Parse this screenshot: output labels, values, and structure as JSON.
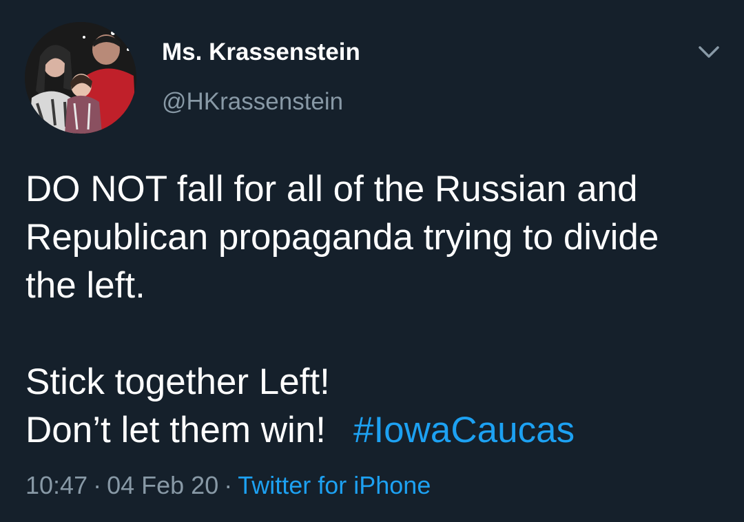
{
  "author": {
    "display_name": "Ms. Krassenstein",
    "handle": "@HKrassenstein"
  },
  "tweet": {
    "lines": [
      "DO NOT fall for all of the Russian and",
      "Republican propaganda trying to divide",
      "the left.",
      "Stick together Left!",
      "Don’t let them win!"
    ],
    "hashtag": "#IowaCaucas"
  },
  "meta": {
    "time": "10:47",
    "date": "04 Feb 20",
    "separator": "·",
    "source": "Twitter for iPhone"
  },
  "colors": {
    "background": "#15202b",
    "link": "#1da1f2",
    "secondary_text": "#8899a6",
    "primary_text": "#ffffff"
  },
  "icons": {
    "menu": "chevron-down-icon"
  }
}
